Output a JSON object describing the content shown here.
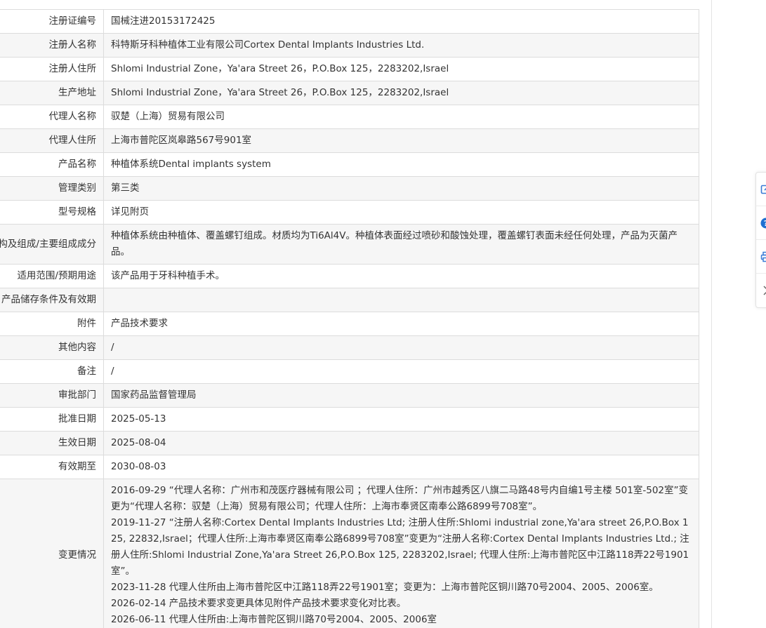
{
  "rows": [
    {
      "label": "注册证编号",
      "value": "国械注进20153172425"
    },
    {
      "label": "注册人名称",
      "value": "科特斯牙科种植体工业有限公司Cortex Dental Implants Industries Ltd."
    },
    {
      "label": "注册人住所",
      "value": "Shlomi Industrial Zone，Ya'ara Street 26，P.O.Box 125，2283202,Israel"
    },
    {
      "label": "生产地址",
      "value": "Shlomi Industrial Zone，Ya'ara Street 26，P.O.Box 125，2283202,Israel"
    },
    {
      "label": "代理人名称",
      "value": "驭楚（上海）贸易有限公司"
    },
    {
      "label": "代理人住所",
      "value": "上海市普陀区岚皋路567号901室"
    },
    {
      "label": "产品名称",
      "value": "种植体系统Dental implants system"
    },
    {
      "label": "管理类别",
      "value": "第三类"
    },
    {
      "label": "型号规格",
      "value": "详见附页"
    },
    {
      "label": "结构及组成/主要组成成分",
      "value": "种植体系统由种植体、覆盖螺钉组成。材质均为Ti6Al4V。种植体表面经过喷砂和酸蚀处理，覆盖螺钉表面未经任何处理，产品为灭菌产品。"
    },
    {
      "label": "适用范围/预期用途",
      "value": "该产品用于牙科种植手术。"
    },
    {
      "label": "产品储存条件及有效期",
      "value": ""
    },
    {
      "label": "附件",
      "value": "产品技术要求"
    },
    {
      "label": "其他内容",
      "value": "/"
    },
    {
      "label": "备注",
      "value": "/"
    },
    {
      "label": "审批部门",
      "value": "国家药品监督管理局"
    },
    {
      "label": "批准日期",
      "value": "2025-05-13"
    },
    {
      "label": "生效日期",
      "value": "2025-08-04"
    },
    {
      "label": "有效期至",
      "value": "2030-08-03"
    }
  ],
  "changes": {
    "label": "变更情况",
    "lines": [
      "2016-09-29 “代理人名称：广州市和茂医疗器械有限公司 ；代理人住所：广州市越秀区八旗二马路48号内自编1号主楼 501室-502室”变更为“代理人名称：驭楚（上海）贸易有限公司；代理人住所：上海市奉贤区南奉公路6899号708室”。",
      "2019-11-27 “注册人名称:Cortex Dental Implants Industries Ltd; 注册人住所:Shlomi industrial zone,Ya'ara street 26,P.O.Box 125, 22832,Israel；代理人住所:上海市奉贤区南奉公路6899号708室”变更为“注册人名称:Cortex Dental Implants Industries Ltd.; 注册人住所:Shlomi Industrial Zone,Ya'ara Street 26,P.O.Box 125, 2283202,Israel; 代理人住所:上海市普陀区中江路118弄22号1901室”。",
      "2023-11-28 代理人住所由上海市普陀区中江路118弄22号1901室；变更为：上海市普陀区铜川路70号2004、2005、2006室。",
      "2026-02-14 产品技术要求变更具体见附件产品技术要求变化对比表。",
      "2026-06-11 代理人住所由:上海市普陀区铜川路70号2004、2005、2006室"
    ]
  },
  "side_tools": [
    {
      "icon": "open-window-icon"
    },
    {
      "icon": "help-icon"
    },
    {
      "icon": "print-icon"
    },
    {
      "icon": "chevron-right-icon"
    }
  ],
  "colors": {
    "accent": "#3a7bd5",
    "help": "#1f6fd1",
    "border": "#dcdcdc",
    "row_alt": "#f6f6f6"
  }
}
